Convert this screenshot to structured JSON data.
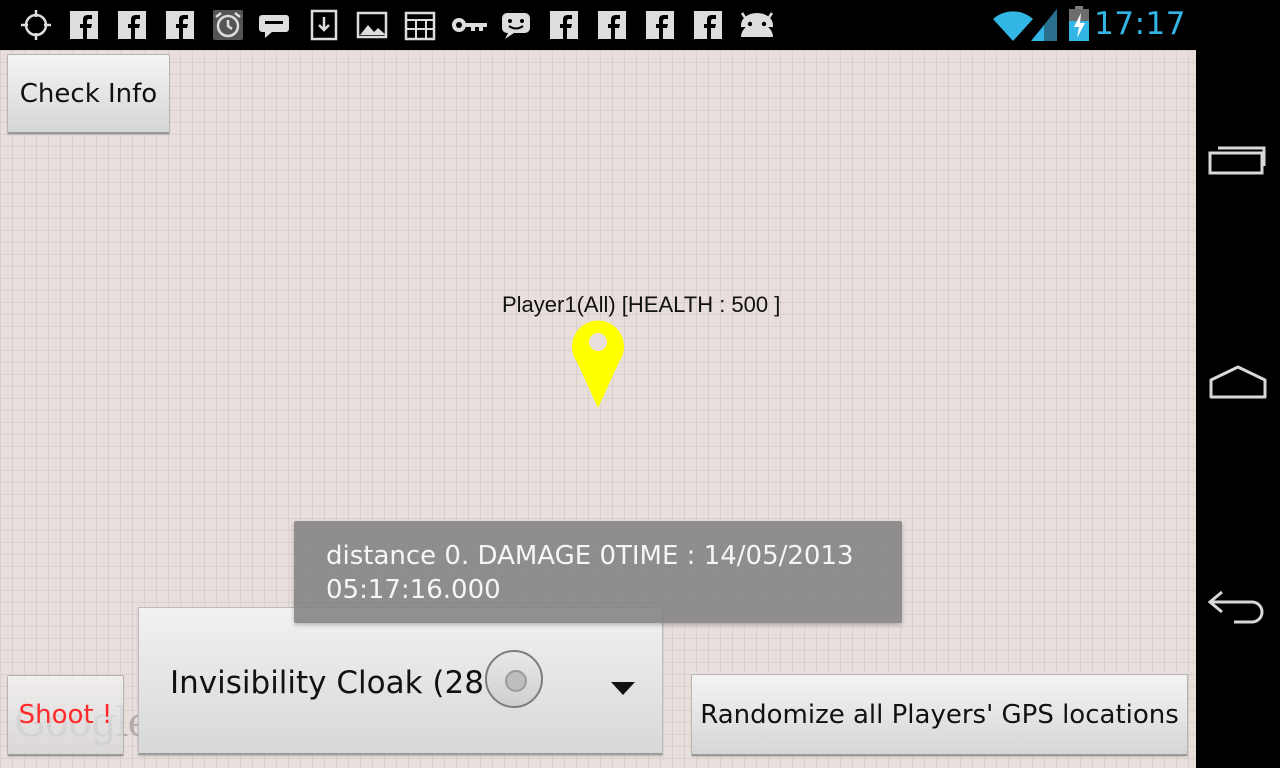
{
  "status_bar": {
    "time": "17:17",
    "left_icons": [
      "gps-icon",
      "facebook-icon",
      "facebook-icon",
      "facebook-icon",
      "alarm-icon",
      "chat-icon",
      "download-icon",
      "image-icon",
      "calendar-icon",
      "key-icon",
      "messenger-icon",
      "facebook-icon",
      "facebook-icon",
      "facebook-icon",
      "facebook-icon",
      "android-icon"
    ],
    "accent_color": "#33b5e5"
  },
  "map": {
    "check_info_label": "Check Info",
    "player_label": "Player1(All) [HEALTH : 500 ]",
    "marker_color": "#ffff00",
    "google_logo_text": "Google",
    "toast_text": "distance 0. DAMAGE 0TIME : 14/05/2013 05:17:16.000",
    "spinner_label": "Invisibility Cloak (28 )",
    "shoot_label": "Shoot !",
    "shoot_color": "#ff2a2a",
    "randomize_label": "Randomize all Players' GPS locations"
  },
  "nav_bar": {
    "buttons": [
      "recent-apps-icon",
      "home-icon",
      "back-icon"
    ]
  }
}
